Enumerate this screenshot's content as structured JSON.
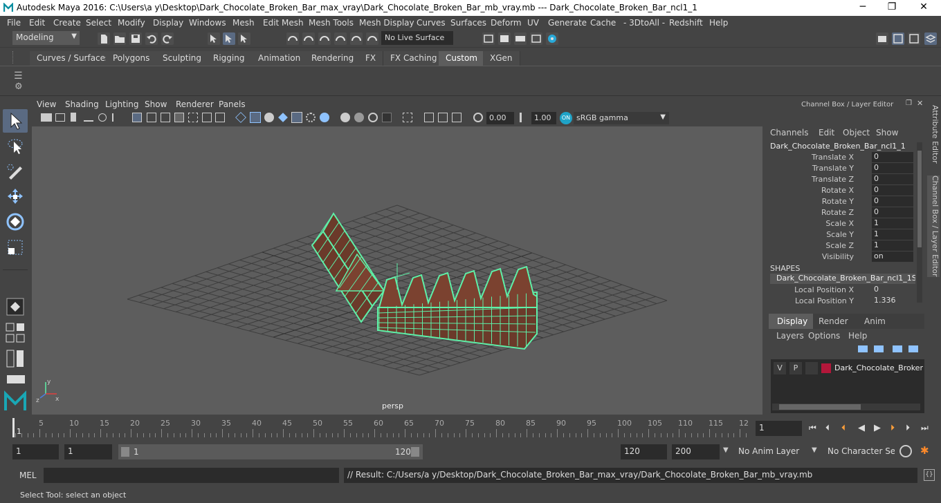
{
  "window": {
    "title": "Autodesk Maya 2016: C:\\Users\\a y\\Desktop\\Dark_Chocolate_Broken_Bar_max_vray\\Dark_Chocolate_Broken_Bar_mb_vray.mb   ---   Dark_Chocolate_Broken_Bar_ncl1_1",
    "minimize": "─",
    "maximize": "❐",
    "close": "✕"
  },
  "menubar": {
    "items": [
      "File",
      "Edit",
      "Create",
      "Select",
      "Modify",
      "Display",
      "Windows",
      "Mesh",
      "Edit Mesh",
      "Mesh Tools",
      "Mesh Display",
      "Curves",
      "Surfaces",
      "Deform",
      "UV",
      "Generate",
      "Cache",
      "- 3DtoAll -",
      "Redshift",
      "Help"
    ]
  },
  "statusline": {
    "mode": "Modeling",
    "live_surface": "No Live Surface"
  },
  "shelf": {
    "tabs": [
      "Curves / Surfaces",
      "Polygons",
      "Sculpting",
      "Rigging",
      "Animation",
      "Rendering",
      "FX",
      "FX Caching",
      "Custom",
      "XGen"
    ],
    "active_tab": "Custom"
  },
  "panel": {
    "menus": [
      "View",
      "Shading",
      "Lighting",
      "Show",
      "Renderer",
      "Panels"
    ],
    "exposure": "0.00",
    "gamma": "1.00",
    "color_space": "sRGB gamma",
    "camera_label": "persp"
  },
  "channel_box": {
    "header": "Channel Box / Layer Editor",
    "menus": [
      "Channels",
      "Edit",
      "Object",
      "Show"
    ],
    "object_name": "Dark_Chocolate_Broken_Bar_ncl1_1",
    "attributes": [
      {
        "label": "Translate X",
        "value": "0"
      },
      {
        "label": "Translate Y",
        "value": "0"
      },
      {
        "label": "Translate Z",
        "value": "0"
      },
      {
        "label": "Rotate X",
        "value": "0"
      },
      {
        "label": "Rotate Y",
        "value": "0"
      },
      {
        "label": "Rotate Z",
        "value": "0"
      },
      {
        "label": "Scale X",
        "value": "1"
      },
      {
        "label": "Scale Y",
        "value": "1"
      },
      {
        "label": "Scale Z",
        "value": "1"
      },
      {
        "label": "Visibility",
        "value": "on"
      }
    ],
    "shapes_header": "SHAPES",
    "shape_name": "Dark_Chocolate_Broken_Bar_ncl1_1S...",
    "shape_attributes": [
      {
        "label": "Local Position X",
        "value": "0"
      },
      {
        "label": "Local Position Y",
        "value": "1.336"
      }
    ]
  },
  "layer_editor": {
    "tabs": [
      "Display",
      "Render",
      "Anim"
    ],
    "active_tab": "Display",
    "menus": [
      "Layers",
      "Options",
      "Help"
    ],
    "layer": {
      "v": "V",
      "p": "P",
      "name": "Dark_Chocolate_Broken_",
      "color": "#b3173a"
    }
  },
  "side_tabs": [
    "Attribute Editor",
    "Channel Box / Layer Editor"
  ],
  "timeline": {
    "ticks": [
      "5",
      "10",
      "15",
      "20",
      "25",
      "30",
      "35",
      "40",
      "45",
      "50",
      "55",
      "60",
      "65",
      "70",
      "75",
      "80",
      "85",
      "90",
      "95",
      "100",
      "105",
      "110",
      "115",
      "12"
    ],
    "start_marker": "1",
    "current_frame": "1"
  },
  "range": {
    "start": "1",
    "inner_start": "1",
    "slider_start": "1",
    "slider_end": "120",
    "end": "120",
    "outer_end": "200",
    "anim_layer": "No Anim Layer",
    "character_set": "No Character Set"
  },
  "command": {
    "label": "MEL",
    "result": "// Result: C:/Users/a y/Desktop/Dark_Chocolate_Broken_Bar_max_vray/Dark_Chocolate_Broken_Bar_mb_vray.mb"
  },
  "help": {
    "text": "Select Tool: select an object"
  },
  "colors": {
    "wireframe": "#5ef0a8",
    "chocolate": "#6b3a2a",
    "viewport_bg": "#5d5d5d",
    "active_tab": "#5d5d5d"
  }
}
